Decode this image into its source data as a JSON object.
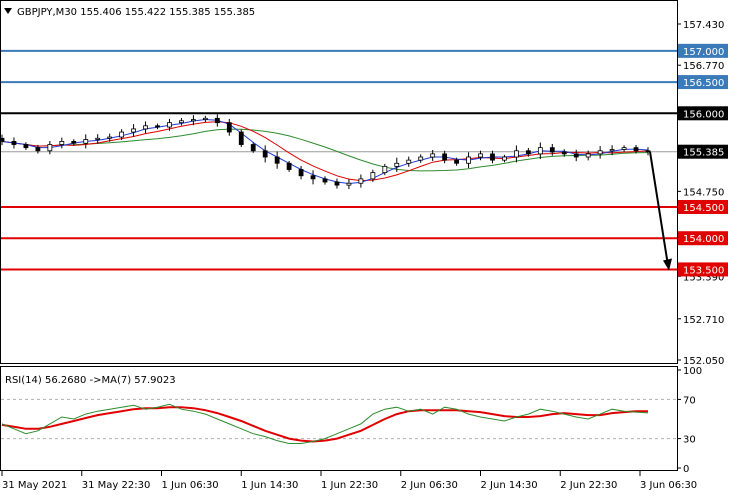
{
  "symbol_header": "GBPJPY,M30  155.406 155.422 155.385 155.385",
  "rsi_header": "RSI(14) 56.2680  ->MA(7) 57.9023",
  "colors": {
    "support": "#e00000",
    "resistance": "#3a7ab8",
    "pivot": "#000000",
    "ma_fast": "#e00000",
    "ma_slow": "#2e8b2e",
    "ma_blue": "#1f3bd6",
    "rsi_line": "#e00000",
    "rsi_ma": "#2e8b2e",
    "current_price_bg": "#000000"
  },
  "chart_data": [
    {
      "type": "candlestick",
      "symbol": "GBPJPY",
      "timeframe": "M30",
      "ylim": [
        152.05,
        157.75
      ],
      "y_ticks": [
        "157.430",
        "156.770",
        "154.750",
        "153.390",
        "152.710",
        "152.050"
      ],
      "x_ticks": [
        "31 May 2021",
        "31 May 22:30",
        "1 Jun 06:30",
        "1 Jun 14:30",
        "1 Jun 22:30",
        "2 Jun 06:30",
        "2 Jun 14:30",
        "2 Jun 22:30",
        "3 Jun 06:30"
      ],
      "current_price": {
        "value": 155.385,
        "label": "155.385"
      },
      "levels": [
        {
          "value": 157.0,
          "label": "157.000",
          "kind": "resistance"
        },
        {
          "value": 156.5,
          "label": "156.500",
          "kind": "resistance"
        },
        {
          "value": 156.0,
          "label": "156.000",
          "kind": "pivot"
        },
        {
          "value": 154.5,
          "label": "154.500",
          "kind": "support"
        },
        {
          "value": 154.0,
          "label": "154.000",
          "kind": "support"
        },
        {
          "value": 153.5,
          "label": "153.500",
          "kind": "support"
        }
      ],
      "forecast_arrow": {
        "from": 155.385,
        "to": 153.5
      },
      "close_path": [
        155.55,
        155.5,
        155.45,
        155.4,
        155.5,
        155.55,
        155.52,
        155.58,
        155.6,
        155.62,
        155.7,
        155.75,
        155.8,
        155.78,
        155.85,
        155.88,
        155.9,
        155.92,
        155.85,
        155.7,
        155.5,
        155.4,
        155.3,
        155.2,
        155.1,
        155.0,
        154.95,
        154.9,
        154.85,
        154.88,
        154.95,
        155.05,
        155.15,
        155.2,
        155.25,
        155.3,
        155.35,
        155.25,
        155.2,
        155.3,
        155.35,
        155.25,
        155.3,
        155.4,
        155.35,
        155.45,
        155.38,
        155.35,
        155.3,
        155.35,
        155.4,
        155.42,
        155.45,
        155.4,
        155.385
      ]
    },
    {
      "type": "line",
      "indicator": "RSI",
      "ylim": [
        0,
        100
      ],
      "y_ticks": [
        "100",
        "70",
        "30",
        "0"
      ],
      "reference_levels": [
        70,
        30
      ],
      "series": [
        {
          "name": "RSI(14)",
          "values": [
            45,
            40,
            35,
            38,
            45,
            52,
            50,
            55,
            58,
            60,
            62,
            64,
            60,
            62,
            65,
            60,
            58,
            55,
            50,
            45,
            40,
            35,
            32,
            28,
            25,
            25,
            27,
            30,
            35,
            40,
            45,
            55,
            60,
            62,
            58,
            60,
            55,
            62,
            60,
            55,
            52,
            50,
            48,
            52,
            55,
            60,
            58,
            55,
            52,
            50,
            55,
            60,
            58,
            57,
            56.268
          ]
        },
        {
          "name": "MA(7)",
          "values": [
            44,
            42,
            40,
            40,
            42,
            45,
            48,
            51,
            54,
            56,
            58,
            60,
            61,
            61,
            62,
            62,
            61,
            59,
            56,
            52,
            48,
            43,
            38,
            34,
            30,
            28,
            27,
            28,
            30,
            34,
            38,
            44,
            50,
            55,
            58,
            59,
            59,
            59,
            59,
            58,
            57,
            55,
            53,
            52,
            52,
            53,
            55,
            56,
            55,
            54,
            54,
            56,
            57,
            58,
            57.902
          ]
        }
      ]
    }
  ]
}
